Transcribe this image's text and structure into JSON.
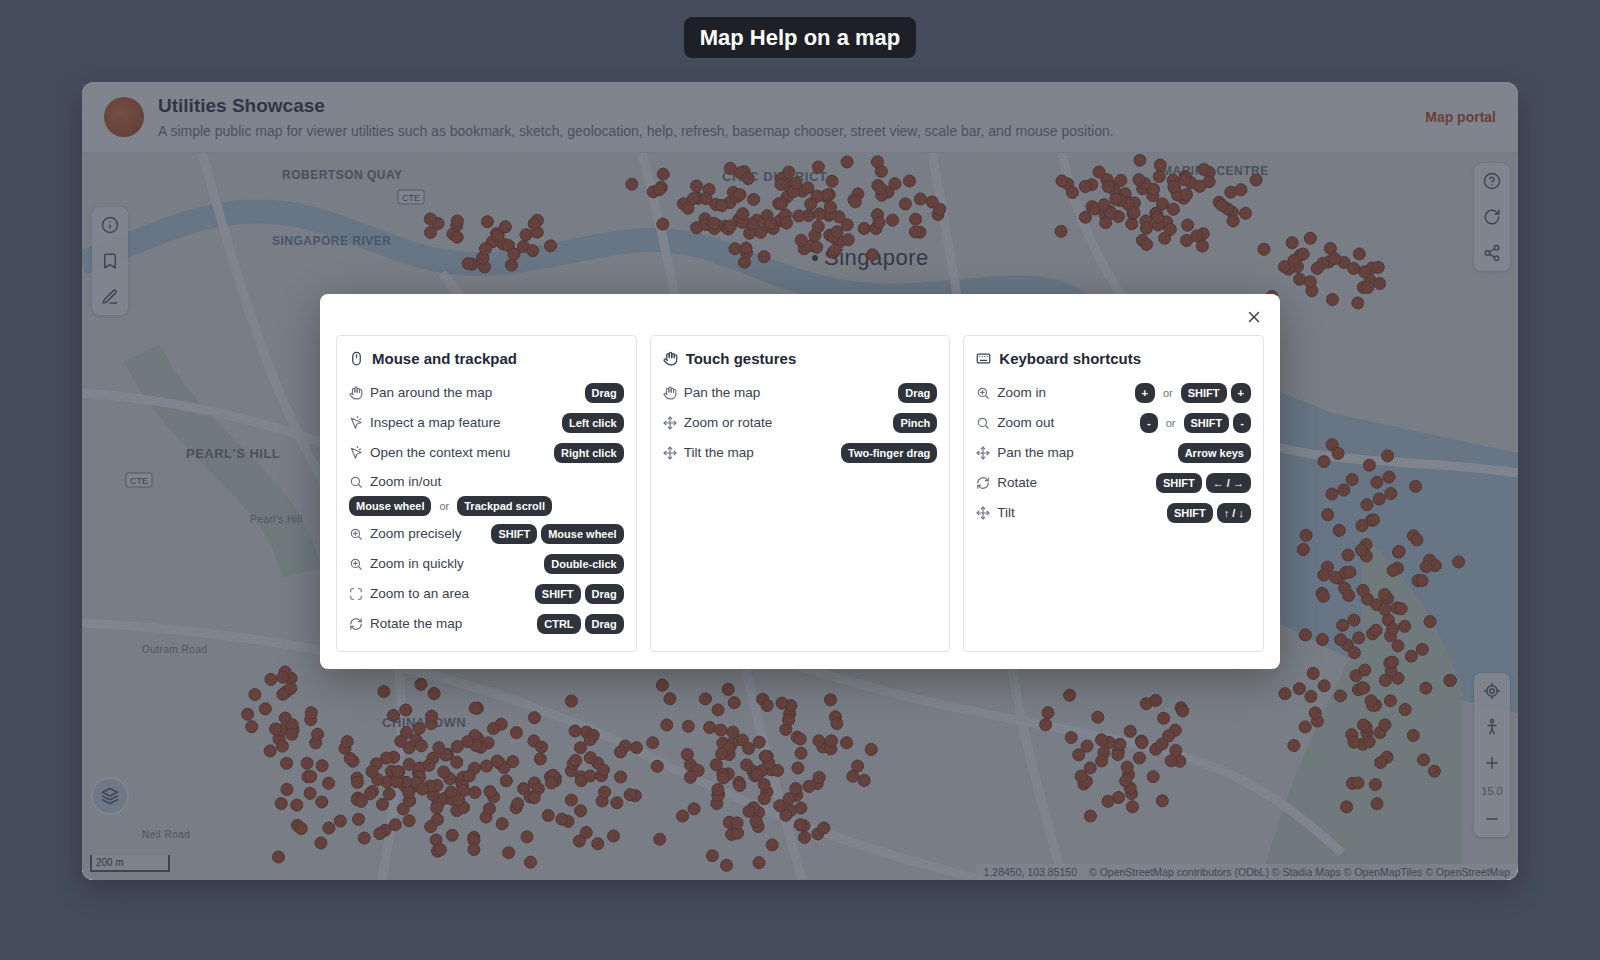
{
  "page_title": "Map Help on a map",
  "header": {
    "title": "Utilities Showcase",
    "subtitle": "A simple public map for viewer utilities such as bookmark, sketch, geolocation, help, refresh, basemap chooser, street view, scale bar, and mouse position.",
    "link": "Map portal"
  },
  "map": {
    "labels": [
      "ROBERTSON QUAY",
      "SINGAPORE RIVER",
      "CIVIC DISTRICT",
      "Singapore",
      "PEARL'S HILL",
      "Pearl's Hill",
      "CHINATOWN",
      "MARINA CENTRE",
      "Outram Road",
      "Neil Road"
    ],
    "road_shields": [
      "CTE",
      "CTE"
    ],
    "zoom": "15.0",
    "scale": "200 m",
    "mouse_position": "1.28450, 103.85150",
    "attribution": "© OpenStreetMap contributors (ODbL) © Stadia Maps © OpenMapTiles © OpenStreetMap"
  },
  "help_dialog": {
    "separator": "or",
    "sections": [
      {
        "title": "Mouse and trackpad",
        "rows": [
          {
            "label": "Pan around the map",
            "keys": [
              [
                "Drag"
              ]
            ],
            "wrap": false
          },
          {
            "label": "Inspect a map feature",
            "keys": [
              [
                "Left click"
              ]
            ],
            "wrap": false
          },
          {
            "label": "Open the context menu",
            "keys": [
              [
                "Right click"
              ]
            ],
            "wrap": false
          },
          {
            "label": "Zoom in/out",
            "keys": [
              [
                "Mouse wheel"
              ],
              [
                "Trackpad scroll"
              ]
            ],
            "wrap": true
          },
          {
            "label": "Zoom precisely",
            "keys": [
              [
                "SHIFT",
                "Mouse wheel"
              ]
            ],
            "wrap": false
          },
          {
            "label": "Zoom in quickly",
            "keys": [
              [
                "Double-click"
              ]
            ],
            "wrap": false
          },
          {
            "label": "Zoom to an area",
            "keys": [
              [
                "SHIFT",
                "Drag"
              ]
            ],
            "wrap": false
          },
          {
            "label": "Rotate the map",
            "keys": [
              [
                "CTRL",
                "Drag"
              ]
            ],
            "wrap": false
          }
        ]
      },
      {
        "title": "Touch gestures",
        "rows": [
          {
            "label": "Pan the map",
            "keys": [
              [
                "Drag"
              ]
            ],
            "wrap": false
          },
          {
            "label": "Zoom or rotate",
            "keys": [
              [
                "Pinch"
              ]
            ],
            "wrap": false
          },
          {
            "label": "Tilt the map",
            "keys": [
              [
                "Two-finger drag"
              ]
            ],
            "wrap": false
          }
        ]
      },
      {
        "title": "Keyboard shortcuts",
        "rows": [
          {
            "label": "Zoom in",
            "keys": [
              [
                "+"
              ],
              [
                "SHIFT",
                "+"
              ]
            ],
            "wrap": false
          },
          {
            "label": "Zoom out",
            "keys": [
              [
                "-"
              ],
              [
                "SHIFT",
                "-"
              ]
            ],
            "wrap": false
          },
          {
            "label": "Pan the map",
            "keys": [
              [
                "Arrow keys"
              ]
            ],
            "wrap": false
          },
          {
            "label": "Rotate",
            "keys": [
              [
                "SHIFT",
                "← / →"
              ]
            ],
            "wrap": false
          },
          {
            "label": "Tilt",
            "keys": [
              [
                "SHIFT",
                "↑ / ↓"
              ]
            ],
            "wrap": false
          }
        ]
      }
    ]
  }
}
